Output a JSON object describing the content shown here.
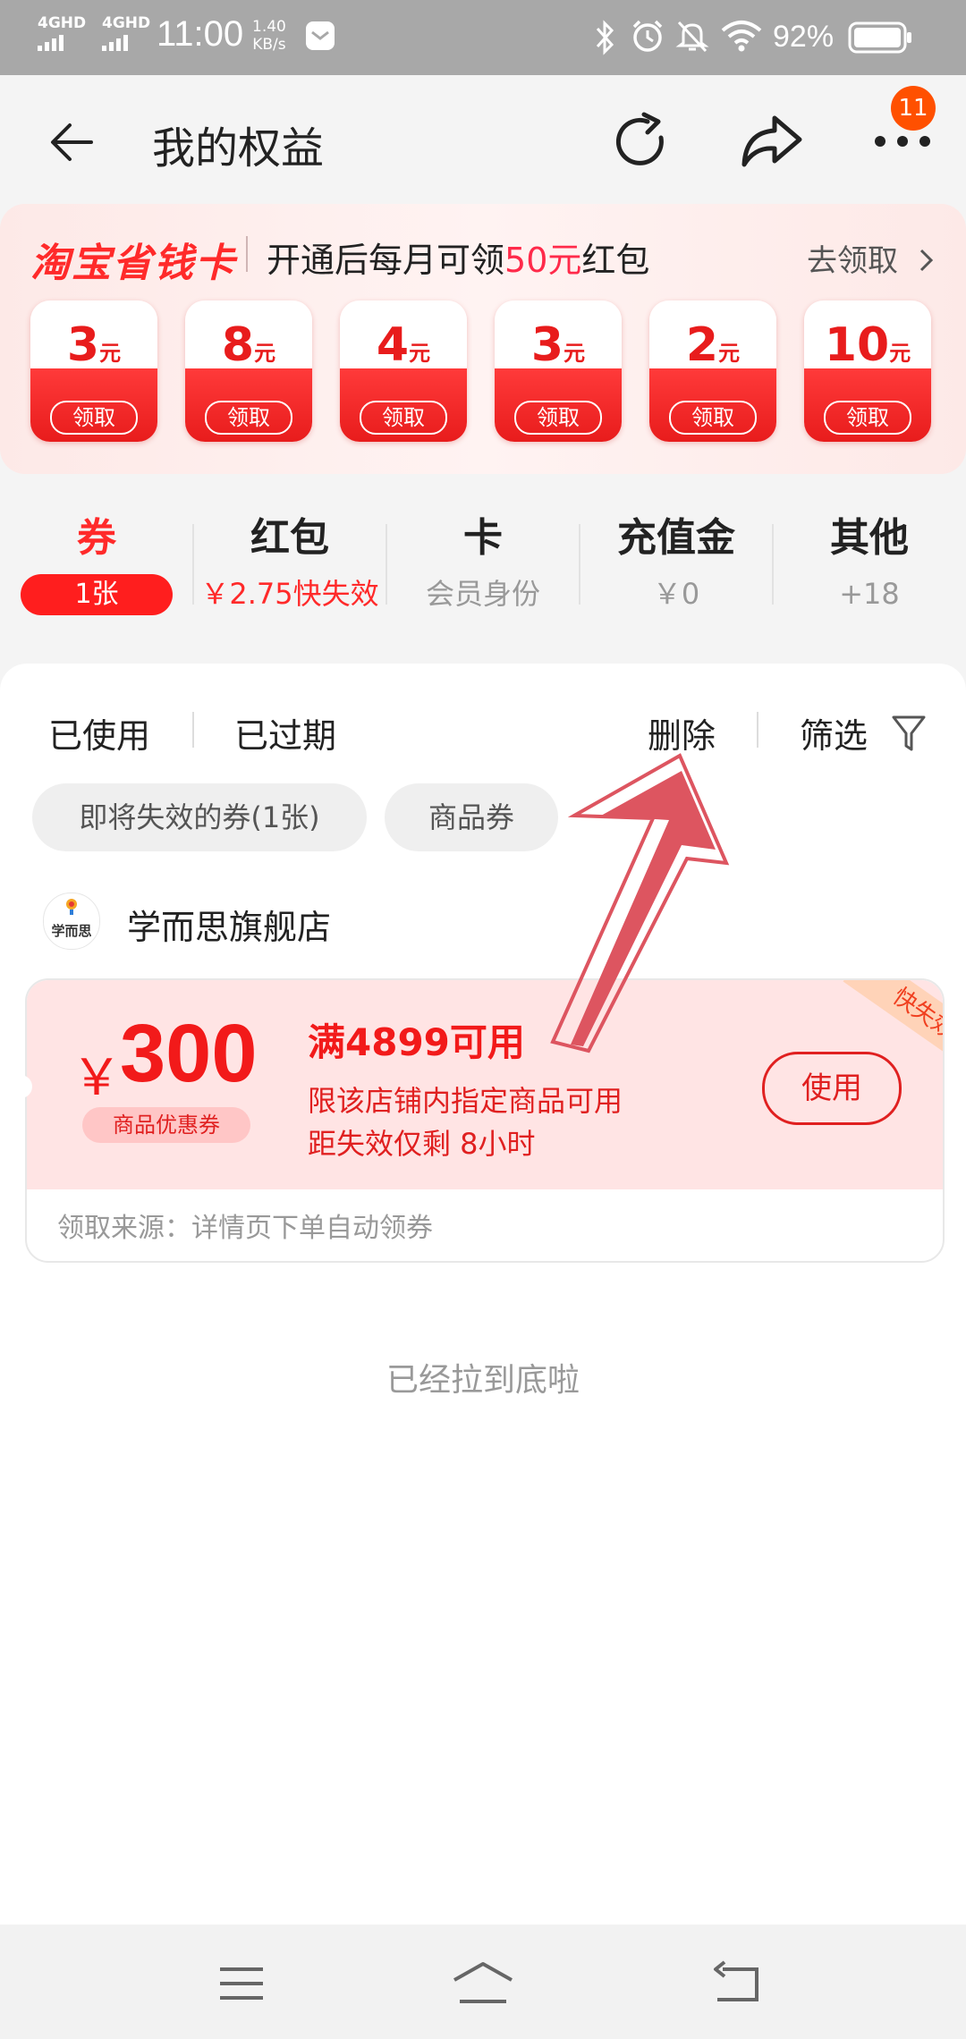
{
  "status_bar": {
    "signal1": "4GHD",
    "signal2": "4GHD",
    "time": "11:00",
    "speed_value": "1.40",
    "speed_unit": "KB/s",
    "battery": "92%"
  },
  "header": {
    "title": "我的权益",
    "more_badge": "11"
  },
  "banner": {
    "logo": "淘宝省钱卡",
    "text_prefix": "开通后每月可领",
    "text_highlight": "50元",
    "text_suffix": "红包",
    "action": "去领取",
    "coupons": [
      {
        "amount": "3",
        "unit": "元",
        "button": "领取"
      },
      {
        "amount": "8",
        "unit": "元",
        "button": "领取"
      },
      {
        "amount": "4",
        "unit": "元",
        "button": "领取"
      },
      {
        "amount": "3",
        "unit": "元",
        "button": "领取"
      },
      {
        "amount": "2",
        "unit": "元",
        "button": "领取"
      },
      {
        "amount": "10",
        "unit": "元",
        "button": "领取"
      }
    ]
  },
  "categories": [
    {
      "title": "券",
      "sub": "1张"
    },
    {
      "title": "红包",
      "sub": "￥2.75快失效"
    },
    {
      "title": "卡",
      "sub": "会员身份"
    },
    {
      "title": "充值金",
      "sub": "￥0"
    },
    {
      "title": "其他",
      "sub": "+18"
    }
  ],
  "filters": {
    "used": "已使用",
    "expired": "已过期",
    "delete": "删除",
    "filter": "筛选"
  },
  "chips": [
    "即将失效的券(1张)",
    "商品券"
  ],
  "store": {
    "logo_text": "学而思",
    "name": "学而思旗舰店"
  },
  "coupon": {
    "currency": "￥",
    "amount": "300",
    "tag": "商品优惠券",
    "condition": "满4899可用",
    "desc1": "限该店铺内指定商品可用",
    "desc2": "距失效仅剩 8小时",
    "use_button": "使用",
    "ribbon": "快失效",
    "source": "领取来源：详情页下单自动领券"
  },
  "footer_text": "已经拉到底啦",
  "colors": {
    "accent": "#ff2a2a",
    "badge": "#ff5000",
    "annotation_arrow": "#dd5560"
  }
}
